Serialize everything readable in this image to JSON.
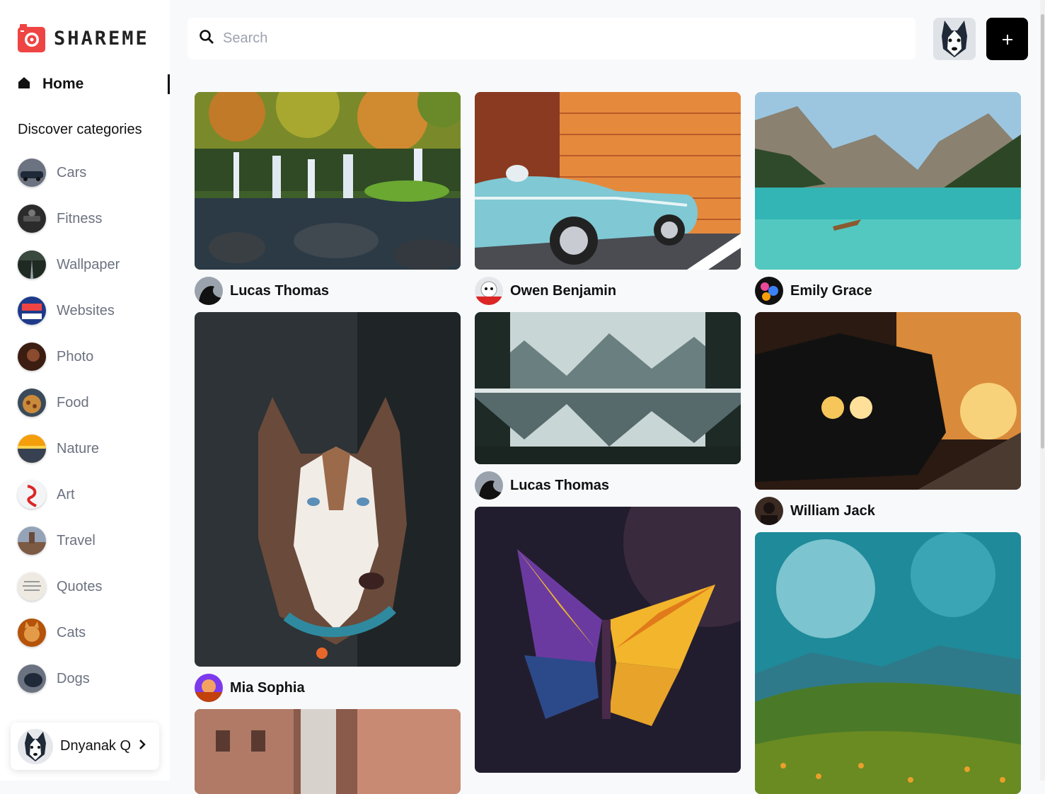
{
  "app": {
    "name": "SHAREME"
  },
  "nav": {
    "home_label": "Home",
    "discover_heading": "Discover categories"
  },
  "categories": [
    {
      "label": "Cars",
      "color": "#4a5563"
    },
    {
      "label": "Fitness",
      "color": "#2b2b2b"
    },
    {
      "label": "Wallpaper",
      "color": "#2f3b2f"
    },
    {
      "label": "Websites",
      "color": "#1e3a8a"
    },
    {
      "label": "Photo",
      "color": "#5a2e1c"
    },
    {
      "label": "Food",
      "color": "#8a5a2b"
    },
    {
      "label": "Nature",
      "color": "#d97741"
    },
    {
      "label": "Art",
      "color": "#e5e5e5"
    },
    {
      "label": "Travel",
      "color": "#7c6a5a"
    },
    {
      "label": "Quotes",
      "color": "#eeeae2"
    },
    {
      "label": "Cats",
      "color": "#d18a3a"
    },
    {
      "label": "Dogs",
      "color": "#4b5563"
    }
  ],
  "user": {
    "name": "Dnyanak Q"
  },
  "search": {
    "placeholder": "Search"
  },
  "accent_color": "#ef4444",
  "pins": [
    {
      "author": "Lucas Thomas",
      "image": "waterfall"
    },
    {
      "author": "Owen Benjamin",
      "image": "blue-convertible"
    },
    {
      "author": "Emily Grace",
      "image": "mountain-lake"
    },
    {
      "author": "Mia Sophia",
      "image": "husky"
    },
    {
      "author": "Lucas Thomas",
      "image": "lake-reflection"
    },
    {
      "author": "William Jack",
      "image": "car-sunset"
    },
    {
      "author": "",
      "image": "origami-butterfly"
    },
    {
      "author": "",
      "image": "green-valley"
    },
    {
      "author": "",
      "image": "street"
    }
  ]
}
